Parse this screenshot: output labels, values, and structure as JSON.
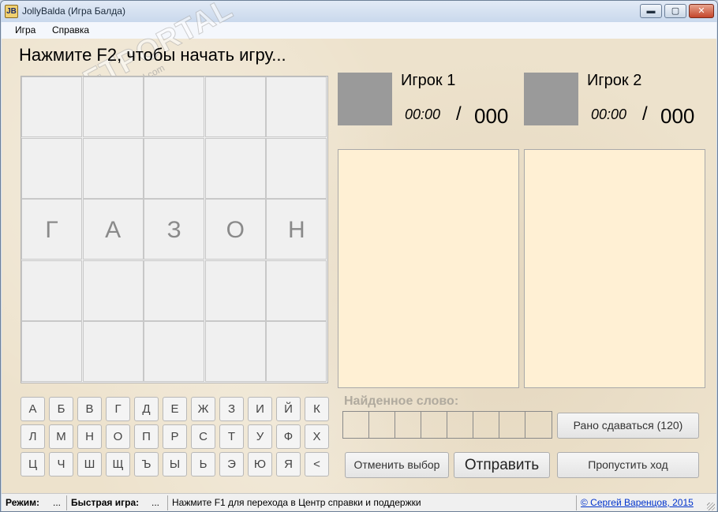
{
  "window": {
    "title": "JollyBalda (Игра Балда)",
    "icon_text": "JB",
    "min_glyph": "▬",
    "max_glyph": "▢",
    "close_glyph": "✕"
  },
  "menu": [
    "Игра",
    "Справка"
  ],
  "watermark": {
    "main": "SOFTPORTAL",
    "sub": "www.softportal.com"
  },
  "prompt": "Нажмите F2, чтобы начать игру...",
  "board": {
    "rows": [
      [
        "",
        "",
        "",
        "",
        ""
      ],
      [
        "",
        "",
        "",
        "",
        ""
      ],
      [
        "Г",
        "А",
        "З",
        "О",
        "Н"
      ],
      [
        "",
        "",
        "",
        "",
        ""
      ],
      [
        "",
        "",
        "",
        "",
        ""
      ]
    ]
  },
  "players": [
    {
      "name": "Игрок 1",
      "time": "00:00",
      "separator": "/",
      "score": "000"
    },
    {
      "name": "Игрок 2",
      "time": "00:00",
      "separator": "/",
      "score": "000"
    }
  ],
  "keyboard": [
    [
      "А",
      "Б",
      "В",
      "Г",
      "Д",
      "Е",
      "Ж",
      "З",
      "И",
      "Й",
      "К"
    ],
    [
      "Л",
      "М",
      "Н",
      "О",
      "П",
      "Р",
      "С",
      "Т",
      "У",
      "Ф",
      "Х"
    ],
    [
      "Ц",
      "Ч",
      "Ш",
      "Щ",
      "Ъ",
      "Ы",
      "Ь",
      "Э",
      "Ю",
      "Я",
      "<"
    ]
  ],
  "found_word": {
    "label": "Найденное слово:",
    "slots": 8
  },
  "buttons": {
    "give_up": "Рано сдаваться (120)",
    "cancel": "Отменить выбор",
    "send": "Отправить",
    "skip": "Пропустить ход"
  },
  "status": {
    "mode_label": "Режим:",
    "mode_value": "...",
    "quick_label": "Быстрая игра:",
    "quick_value": "...",
    "hint": "Нажмите F1 для перехода в Центр справки и поддержки",
    "copyright": "© Сергей Варенцов, 2015"
  }
}
